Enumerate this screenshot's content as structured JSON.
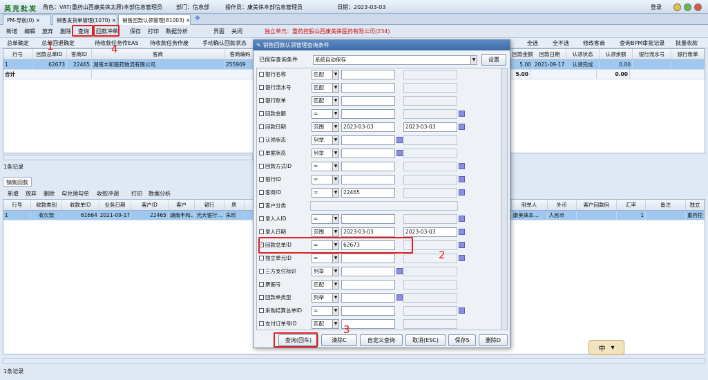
{
  "titlebar": {
    "logo": "英克批发",
    "role": "角色：VAT(重药山西康美徕太原)本部信息管理员",
    "dept": "部门：信息部",
    "operator": "操作员：康美徕本部信息管理员",
    "date": "日期：2023-03-03",
    "login": "登录"
  },
  "tabs": [
    "PM-导航(0)",
    "销售发货单管理(1070)",
    "销售回款认领管理(81003)"
  ],
  "toolbar": {
    "items": [
      "新增",
      "编辑",
      "放弃",
      "删除",
      "查询",
      "回款冲单",
      "保存",
      "打印",
      "数据分析",
      "界面",
      "关闭"
    ],
    "unit": "独立单元：重药控股山西康美徕医药有限公司(234)"
  },
  "toolbar2": {
    "items": [
      "总单确定",
      "总单回退确定",
      "待收款任务传EAS",
      "待收款任务作废",
      "手动确认回款状态",
      "全选",
      "全不选",
      "修改客商",
      "查询BPM审批记录",
      "批量收款"
    ]
  },
  "grid1": {
    "headers_left": [
      "行号",
      "回款总单ID",
      "客商ID",
      "客商",
      "客商编码"
    ],
    "headers_right": [
      "回款金额",
      "回款日期",
      "认领状态",
      "认领余额",
      "银行流水号",
      "银行账单"
    ],
    "row": {
      "no": "1",
      "id": "62673",
      "cid": "22465",
      "name": "湖南丰和医药物流有限公司",
      "code": "255909",
      "amount": "5.00",
      "date": "2021-09-17",
      "status": "认领完成",
      "balance": "0.00"
    },
    "total": {
      "label": "合计",
      "amount": "5.00",
      "balance": "0.00"
    },
    "count": "1条记录"
  },
  "section2": {
    "tab": "销售回款",
    "toolbar": [
      "新增",
      "放弃",
      "删除",
      "勾兑预勾单",
      "收款冲调",
      "打印",
      "数据分析"
    ]
  },
  "grid2": {
    "headers_left": [
      "行号",
      "收款类别",
      "收款单ID",
      "业务日期",
      "客户ID",
      "客户",
      "银行",
      "房"
    ],
    "headers_right": [
      "制单人",
      "外币",
      "客户回款码",
      "汇率",
      "备注",
      "独立"
    ],
    "row": {
      "no": "1",
      "type": "收欠款",
      "id": "61664",
      "date": "2021-09-17",
      "cid": "22465",
      "cust": "湖南丰和…",
      "bank": "光大银行…",
      "f": "朱珍",
      "maker": "康美徕本…",
      "cur": "人民币",
      "rate": "1",
      "extra": "重药控"
    },
    "count": "1条记录"
  },
  "dialog": {
    "title": "销售回款认领管理查询条件",
    "saved_label": "已保存查询条件",
    "saved_value": "系统自动保存",
    "settings": "设置",
    "fields": [
      {
        "label": "银行名称",
        "op": "匹配",
        "v1": "",
        "v2": "",
        "checked": false
      },
      {
        "label": "银行流水号",
        "op": "匹配",
        "v1": "",
        "v2": "",
        "checked": false
      },
      {
        "label": "银行账单",
        "op": "匹配",
        "v1": "",
        "v2": "",
        "checked": false
      },
      {
        "label": "回款金额",
        "op": "=",
        "v1": "",
        "v2": "",
        "checked": false
      },
      {
        "label": "回款日期",
        "op": "范围",
        "v1": "2023-03-03",
        "v2": "2023-03-03",
        "checked": false
      },
      {
        "label": "认领状态",
        "op": "列举",
        "v1": "",
        "v2": "",
        "checked": false
      },
      {
        "label": "单据状态",
        "op": "列举",
        "v1": "",
        "v2": "",
        "checked": false
      },
      {
        "label": "回款方式ID",
        "op": "=",
        "v1": "",
        "v2": "",
        "checked": false
      },
      {
        "label": "银行ID",
        "op": "=",
        "v1": "",
        "v2": "",
        "checked": false
      },
      {
        "label": "客商ID",
        "op": "=",
        "v1": "22465",
        "v2": "",
        "checked": false
      },
      {
        "label": "客户分类",
        "op": "",
        "v1": "",
        "v2": "",
        "checked": false
      },
      {
        "label": "录入人ID",
        "op": "=",
        "v1": "",
        "v2": "",
        "checked": false
      },
      {
        "label": "录入日期",
        "op": "范围",
        "v1": "2023-03-03",
        "v2": "2023-03-03",
        "checked": false
      },
      {
        "label": "回款总单ID",
        "op": "=",
        "v1": "62673",
        "v2": "",
        "checked": true
      },
      {
        "label": "独立单元ID",
        "op": "=",
        "v1": "",
        "v2": "",
        "checked": false
      },
      {
        "label": "三方支付标识",
        "op": "列举",
        "v1": "",
        "v2": "",
        "checked": false
      },
      {
        "label": "票据号",
        "op": "匹配",
        "v1": "",
        "v2": "",
        "checked": false
      },
      {
        "label": "回款单类型",
        "op": "列举",
        "v1": "",
        "v2": "",
        "checked": false
      },
      {
        "label": "采购结算总单ID",
        "op": "=",
        "v1": "",
        "v2": "",
        "checked": false
      },
      {
        "label": "支付订单号ID",
        "op": "匹配",
        "v1": "",
        "v2": "",
        "checked": false
      }
    ],
    "buttons": [
      "查询(回车)",
      "清除C",
      "自定义查询",
      "取消(ESC)",
      "保存S",
      "删除D"
    ]
  },
  "annotations": [
    "1",
    "2",
    "3",
    "4"
  ],
  "ime": "中"
}
